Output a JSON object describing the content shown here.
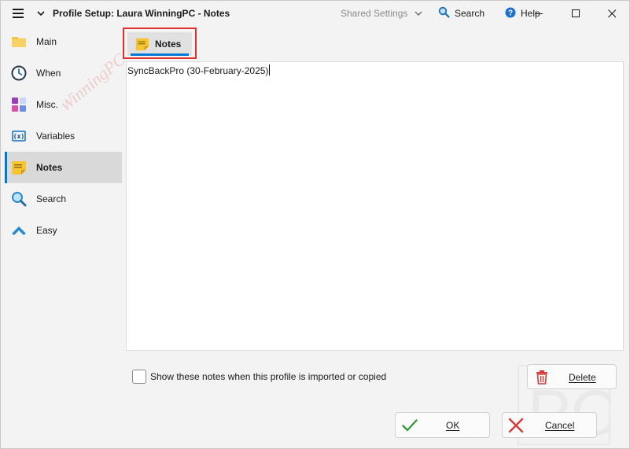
{
  "titlebar": {
    "title": "Profile Setup: Laura WinningPC - Notes",
    "shared_settings": "Shared Settings",
    "search_label": "Search",
    "help_label": "Help"
  },
  "sidebar": {
    "items": [
      {
        "label": "Main",
        "icon": "folder-icon"
      },
      {
        "label": "When",
        "icon": "clock-icon"
      },
      {
        "label": "Misc.",
        "icon": "blocks-icon"
      },
      {
        "label": "Variables",
        "icon": "variables-icon"
      },
      {
        "label": "Notes",
        "icon": "sticky-note-icon",
        "active": true
      },
      {
        "label": "Search",
        "icon": "magnifier-icon"
      },
      {
        "label": "Easy",
        "icon": "chevron-up-icon"
      }
    ]
  },
  "tab": {
    "label": "Notes"
  },
  "notes": {
    "text": "SyncBackPro (30-February-2025)"
  },
  "options": {
    "show_notes_label": "Show these notes when this profile is imported or copied",
    "show_notes_checked": false
  },
  "buttons": {
    "delete": "Delete",
    "ok": "OK",
    "cancel": "Cancel"
  },
  "watermark": {
    "text": "WinningPC",
    "mark": "PC"
  },
  "colors": {
    "accent": "#0078d4",
    "highlight": "#e0312e",
    "active_bg": "#d9d9d9"
  }
}
